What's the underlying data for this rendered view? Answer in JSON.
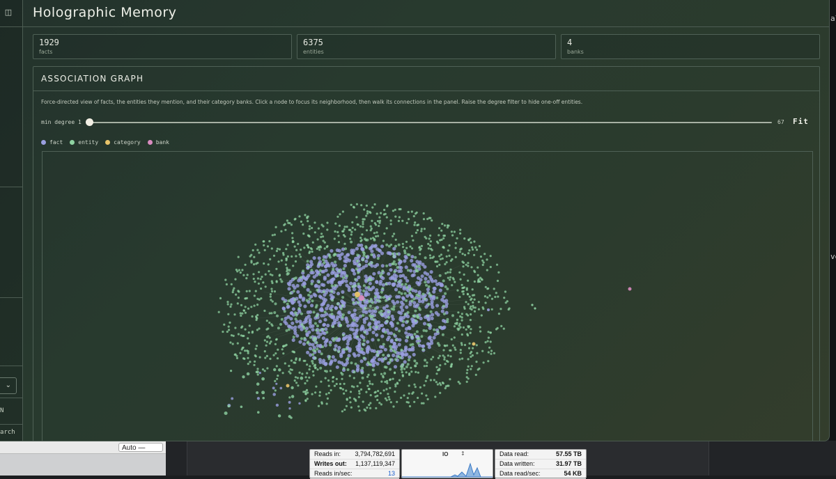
{
  "app": {
    "title": "Holographic Memory"
  },
  "stats": [
    {
      "value": "1929",
      "label": "facts"
    },
    {
      "value": "6375",
      "label": "entities"
    },
    {
      "value": "4",
      "label": "banks"
    }
  ],
  "graph_panel": {
    "title": "ASSOCIATION GRAPH",
    "description": "Force-directed view of facts, the entities they mention, and their category banks. Click a node to focus its neighborhood, then walk its connections in the panel. Raise the degree filter to hide one-off entities.",
    "degree_filter": {
      "label": "min degree 1",
      "value": 1,
      "min": 1,
      "max": 67,
      "max_label": "67"
    },
    "fit_label": "Fit",
    "legend": [
      {
        "label": "fact",
        "color": "#9a9fe0"
      },
      {
        "label": "entity",
        "color": "#8fd3a2"
      },
      {
        "label": "category",
        "color": "#e9c46a"
      },
      {
        "label": "bank",
        "color": "#d98cc0"
      }
    ]
  },
  "sidebar": {
    "items": [
      "N",
      "arch"
    ]
  },
  "background": {
    "preview_zoom": "Auto — Page",
    "activity_monitor": {
      "left": [
        {
          "label": "Reads in:",
          "value": "3,794,782,691"
        },
        {
          "label": "Writes out:",
          "value": "1,137,119,347"
        },
        {
          "label": "Reads in/sec:",
          "value": "13"
        }
      ],
      "mid_label": "IO",
      "right": [
        {
          "label": "Data read:",
          "value": "57.55 TB"
        },
        {
          "label": "Data written:",
          "value": "31.97 TB"
        },
        {
          "label": "Data read/sec:",
          "value": "54 KB"
        }
      ]
    },
    "right_edge": [
      "al",
      "ve"
    ]
  }
}
